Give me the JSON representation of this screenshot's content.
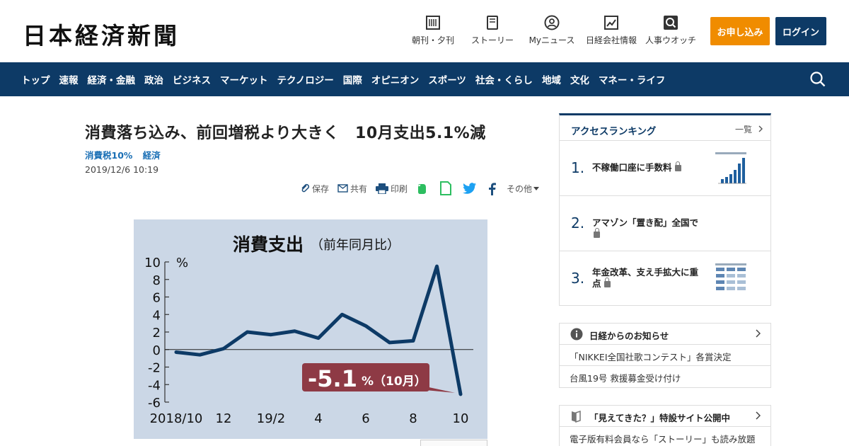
{
  "header": {
    "logo": "日本経済新聞",
    "nav": [
      {
        "label": "朝刊・夕刊",
        "icon": "newspaper-icon"
      },
      {
        "label": "ストーリー",
        "icon": "book-icon"
      },
      {
        "label": "Myニュース",
        "icon": "person-icon"
      },
      {
        "label": "日経会社情報",
        "icon": "chart-icon"
      },
      {
        "label": "人事ウオッチ",
        "icon": "search-icon"
      }
    ],
    "subscribe": "お申し込み",
    "login": "ログイン"
  },
  "navbar": [
    "トップ",
    "速報",
    "経済・金融",
    "政治",
    "ビジネス",
    "マーケット",
    "テクノロジー",
    "国際",
    "オピニオン",
    "スポーツ",
    "社会・くらし",
    "地域",
    "文化",
    "マネー・ライフ"
  ],
  "article": {
    "headline": "消費落ち込み、前回増税より大きく　10月支出5.1%減",
    "tags": [
      "消費税10%",
      "経済"
    ],
    "date": "2019/12/6 10:19",
    "tools": {
      "save": "保存",
      "share": "共有",
      "print": "印刷",
      "more": "その他"
    }
  },
  "chart_data": {
    "type": "line",
    "title": "消費支出",
    "subtitle": "（前年同月比）",
    "ylabel": "%",
    "ylim": [
      -6,
      10
    ],
    "yticks": [
      "10",
      "8",
      "6",
      "4",
      "2",
      "0",
      "-2",
      "-4",
      "-6"
    ],
    "xticks": [
      "2018/10",
      "12",
      "19/2",
      "4",
      "6",
      "8",
      "10"
    ],
    "x": [
      "2018/10",
      "2018/11",
      "2018/12",
      "2019/1",
      "2019/2",
      "2019/3",
      "2019/4",
      "2019/5",
      "2019/6",
      "2019/7",
      "2019/8",
      "2019/9",
      "2019/10"
    ],
    "values": [
      -0.3,
      -0.6,
      0.1,
      2.0,
      1.7,
      2.1,
      1.3,
      4.0,
      2.7,
      0.8,
      1.0,
      9.5,
      -5.1
    ],
    "callout_value": "-5.1",
    "callout_unit": "%（10月）",
    "line_color": "#0d3a66",
    "background": "#cbd7e6"
  },
  "ranking": {
    "title": "アクセスランキング",
    "more": "一覧",
    "items": [
      {
        "rank": "1.",
        "text": "不稼働口座に手数料"
      },
      {
        "rank": "2.",
        "text": "アマゾン「置き配」全国で"
      },
      {
        "rank": "3.",
        "text": "年金改革、支え手拡大に重点"
      }
    ]
  },
  "notice": {
    "title": "日経からのお知らせ",
    "items": [
      "「NIKKEI全国社歌コンテスト」各賞決定",
      "台風19号 救援募金受け付け"
    ]
  },
  "special": {
    "title": "「見えてきた？」特設サイト公開中",
    "items": [
      "電子版有料会員なら「ストーリー」も読み放題"
    ]
  }
}
